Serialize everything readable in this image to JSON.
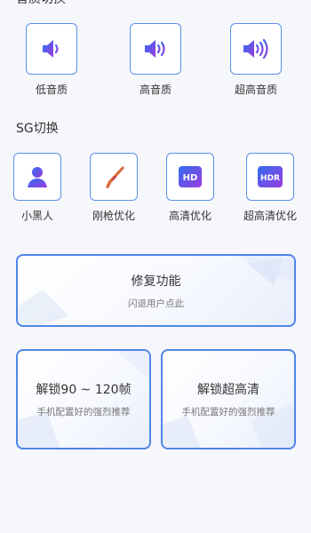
{
  "audio": {
    "title": "音质切换",
    "items": [
      {
        "label": "低音质",
        "icon": "speaker-low-icon"
      },
      {
        "label": "高音质",
        "icon": "speaker-medium-icon"
      },
      {
        "label": "超高音质",
        "icon": "speaker-high-icon"
      }
    ]
  },
  "sg": {
    "title": "SG切换",
    "items": [
      {
        "label": "小黑人",
        "icon": "person-silhouette-icon"
      },
      {
        "label": "刚枪优化",
        "icon": "rifle-icon"
      },
      {
        "label": "高清优化",
        "icon": "hd-icon",
        "badge": "HD"
      },
      {
        "label": "超高清优化",
        "icon": "hdr-icon",
        "badge": "HDR"
      }
    ]
  },
  "cards": {
    "repair": {
      "title": "修复功能",
      "subtitle": "闪退用户点此"
    },
    "unlock_fps": {
      "title": "解锁90 ~ 120帧",
      "subtitle": "手机配置好的强烈推荐"
    },
    "unlock_hd": {
      "title": "解锁超高清",
      "subtitle": "手机配置好的强烈推荐"
    }
  },
  "colors": {
    "accent": "#4f86e6",
    "icon_gradient_start": "#2f6cf0",
    "icon_gradient_end": "#9b3de0"
  }
}
